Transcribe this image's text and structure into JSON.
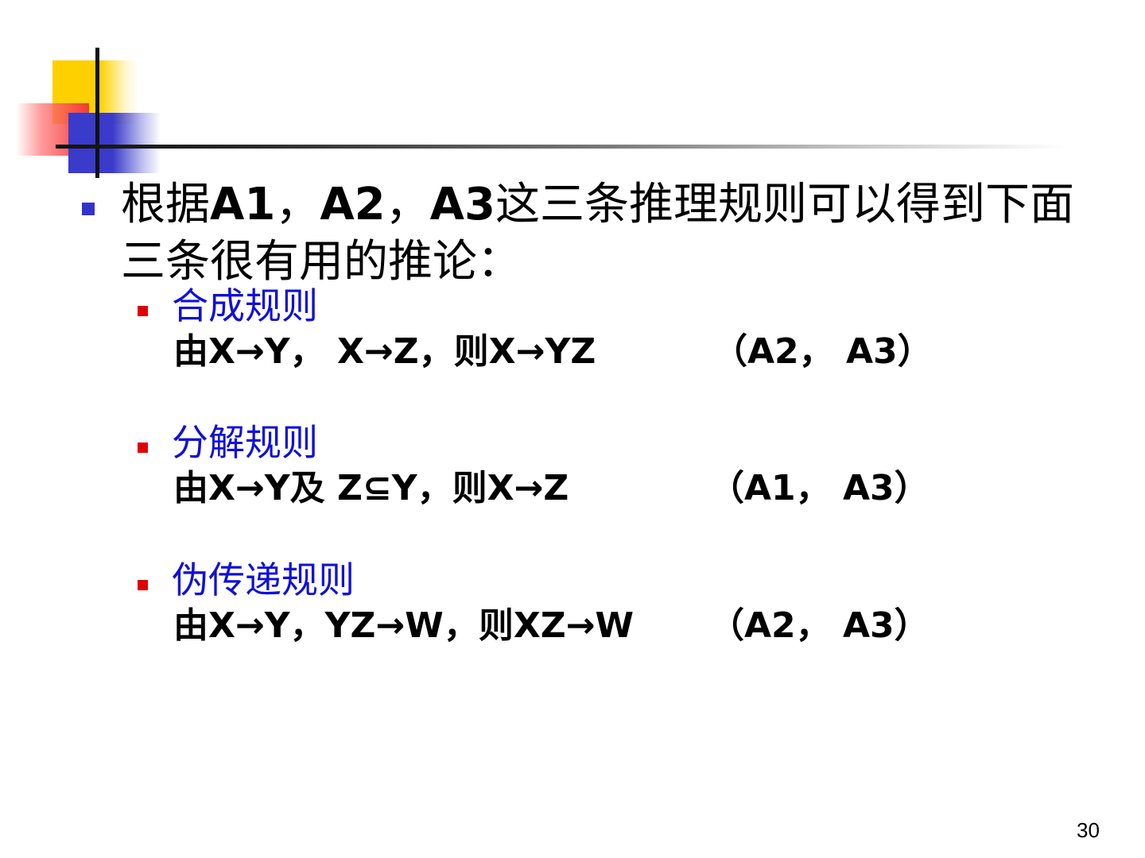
{
  "slide": {
    "intro": {
      "part1": "根据",
      "a1": "A1",
      "sep1": "，",
      "a2": "A2",
      "sep2": "，",
      "a3": "A3",
      "part2": "这三条推理规则可以得到下面",
      "line2": "三条很有用的推论："
    },
    "rules": [
      {
        "title": "合成规则",
        "statement": "由X→Y， X→Z，则X→YZ",
        "reference": "（A2， A3）"
      },
      {
        "title": "分解规则",
        "statement": "由X→Y及 Z⊆Y，则X→Z",
        "reference": "（A1， A3）"
      },
      {
        "title": "伪传递规则",
        "statement": "由X→Y，YZ→W，则XZ→W",
        "reference": "（A2， A3）"
      }
    ],
    "page_number": "30"
  },
  "colors": {
    "main_bullet": "#3333cc",
    "sub_bullet": "#e00000",
    "rule_title": "#1010d8",
    "text": "#000000"
  }
}
